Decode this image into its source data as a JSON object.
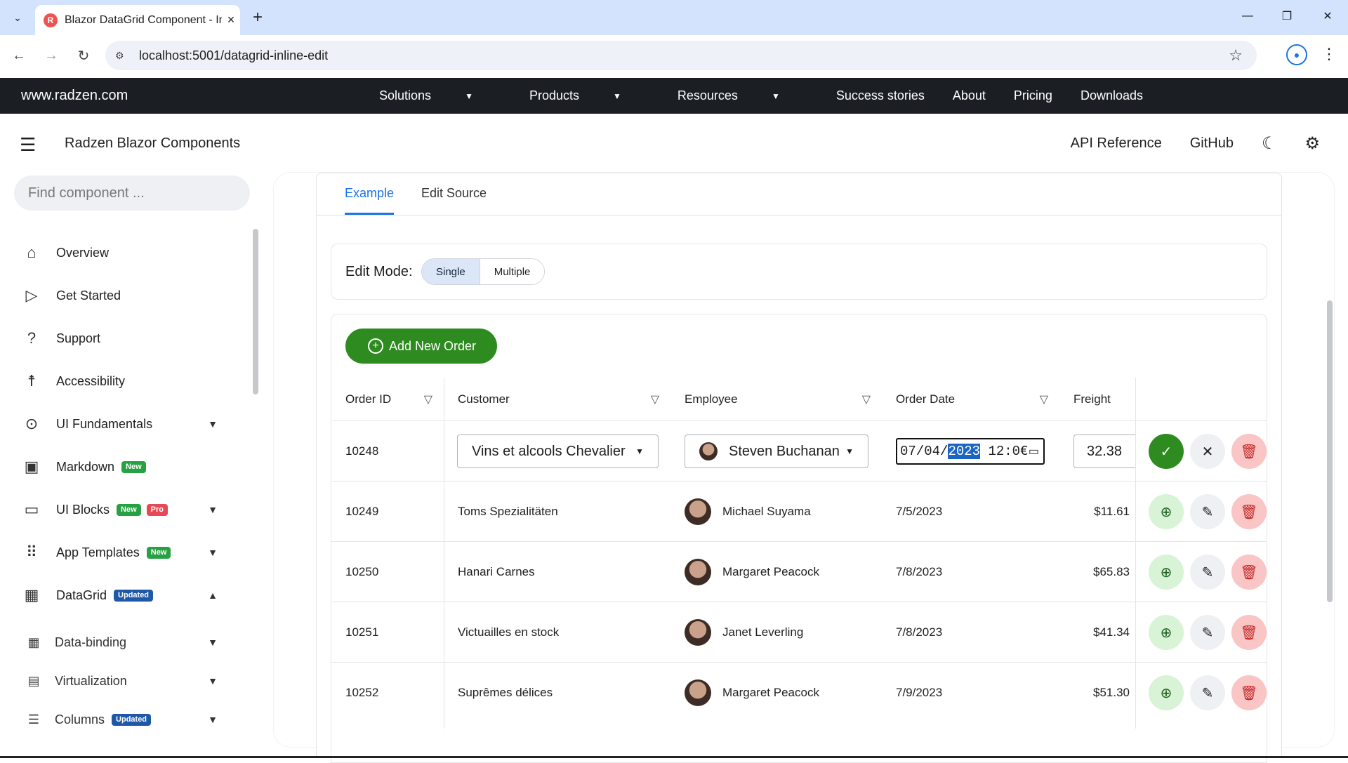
{
  "browser": {
    "tab_title": "Blazor DataGrid Component - In",
    "tab_favicon_letter": "R",
    "url": "localhost:5001/datagrid-inline-edit",
    "window_minimize": "—",
    "window_restore": "❐",
    "window_close": "✕"
  },
  "topnav": {
    "brand": "www.radzen.com",
    "links": [
      "Solutions",
      "Products",
      "Resources",
      "Success stories",
      "About",
      "Pricing",
      "Downloads"
    ]
  },
  "appbar": {
    "title": "Radzen Blazor Components",
    "api_reference": "API Reference",
    "github": "GitHub"
  },
  "sidebar": {
    "search_placeholder": "Find component ...",
    "items": [
      {
        "label": "Overview",
        "icon": "home-icon"
      },
      {
        "label": "Get Started",
        "icon": "play-circle-icon"
      },
      {
        "label": "Support",
        "icon": "help-icon"
      },
      {
        "label": "Accessibility",
        "icon": "accessibility-icon"
      },
      {
        "label": "UI Fundamentals",
        "icon": "fundamentals-icon"
      },
      {
        "label": "Markdown",
        "icon": "markdown-icon",
        "badge": "New"
      },
      {
        "label": "UI Blocks",
        "icon": "blocks-icon",
        "badge": "New",
        "badge2": "Pro"
      },
      {
        "label": "App Templates",
        "icon": "apps-icon",
        "badge": "New"
      },
      {
        "label": "DataGrid",
        "icon": "grid-icon",
        "badge": "Updated"
      }
    ],
    "subitems": [
      {
        "label": "Data-binding"
      },
      {
        "label": "Virtualization"
      },
      {
        "label": "Columns",
        "badge": "Updated"
      }
    ]
  },
  "example": {
    "tab_example": "Example",
    "tab_source": "Edit Source",
    "edit_mode_label": "Edit Mode:",
    "mode_single": "Single",
    "mode_multiple": "Multiple",
    "add_button": "Add New Order"
  },
  "grid": {
    "columns": [
      "Order ID",
      "Customer",
      "Employee",
      "Order Date",
      "Freight"
    ],
    "edit_row": {
      "order_id": "10248",
      "customer": "Vins et alcools Chevalier",
      "employee": "Steven Buchanan",
      "date_month": "07",
      "date_day": "04",
      "date_year": "2023",
      "date_time": "12:0€",
      "freight": "32.38"
    },
    "rows": [
      {
        "order_id": "10249",
        "customer": "Toms Spezialitäten",
        "employee": "Michael Suyama",
        "date": "7/5/2023",
        "freight": "$11.61"
      },
      {
        "order_id": "10250",
        "customer": "Hanari Carnes",
        "employee": "Margaret Peacock",
        "date": "7/8/2023",
        "freight": "$65.83"
      },
      {
        "order_id": "10251",
        "customer": "Victuailles en stock",
        "employee": "Janet Leverling",
        "date": "7/8/2023",
        "freight": "$41.34"
      },
      {
        "order_id": "10252",
        "customer": "Suprêmes délices",
        "employee": "Margaret Peacock",
        "date": "7/9/2023",
        "freight": "$51.30"
      }
    ]
  }
}
